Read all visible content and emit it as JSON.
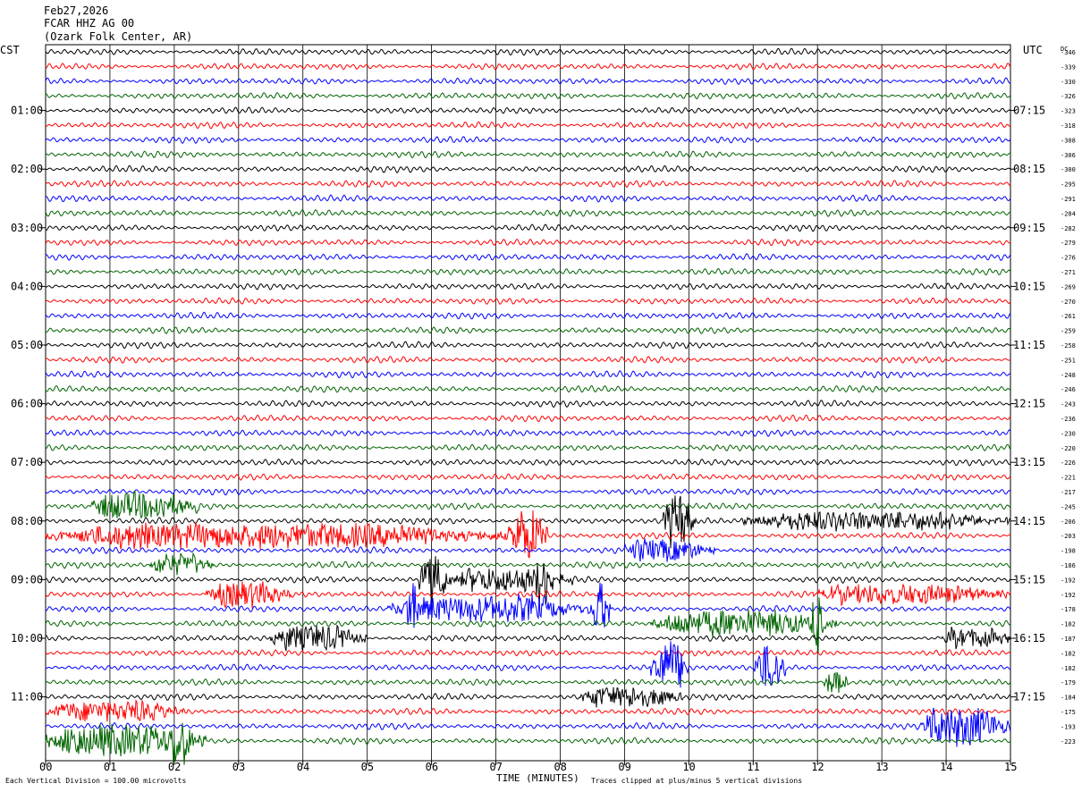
{
  "header": {
    "date": "Feb27,2026",
    "station": "FCAR HHZ AG 00",
    "location": "(Ozark Folk Center, AR)"
  },
  "chart_data": {
    "type": "line",
    "title": "FCAR HHZ AG 00",
    "xlabel": "TIME (MINUTES)",
    "left_axis_label": "CST",
    "right_axis_label": "UTC",
    "dc_label": "DC",
    "x_ticks": [
      "00",
      "01",
      "02",
      "03",
      "04",
      "05",
      "06",
      "07",
      "08",
      "09",
      "10",
      "11",
      "12",
      "13",
      "14",
      "15"
    ],
    "xlim": [
      0,
      15
    ],
    "cst_labels": [
      "01:00",
      "02:00",
      "03:00",
      "04:00",
      "05:00",
      "06:00",
      "07:00",
      "08:00",
      "09:00",
      "10:00",
      "11:00"
    ],
    "utc_labels": [
      "07:15",
      "08:15",
      "09:15",
      "10:15",
      "11:15",
      "12:15",
      "13:15",
      "14:15",
      "15:15",
      "16:15",
      "17:15"
    ],
    "dc_offsets": [
      -346,
      -339,
      -330,
      -326,
      -323,
      -318,
      -308,
      -306,
      -300,
      -295,
      -291,
      -284,
      -282,
      -279,
      -276,
      -271,
      -269,
      -270,
      -261,
      -259,
      -258,
      -251,
      -248,
      -246,
      -243,
      -236,
      -230,
      -220,
      -226,
      -221,
      -217,
      -245,
      -206,
      -203,
      -198,
      -186,
      -192,
      -192,
      -178,
      -182,
      -187,
      -182,
      -182,
      -179,
      -184,
      -175,
      -193,
      -223
    ],
    "trace_colors": [
      "#000000",
      "#ff0000",
      "#0000ff",
      "#006400"
    ],
    "events": [
      {
        "trace": 31,
        "start": 0.7,
        "end": 2.4,
        "amp": 1.8
      },
      {
        "trace": 33,
        "start": 0.0,
        "end": 7.3,
        "amp": 1.6
      },
      {
        "trace": 33,
        "start": 7.2,
        "end": 7.8,
        "amp": 3.5
      },
      {
        "trace": 32,
        "start": 9.6,
        "end": 10.1,
        "amp": 3.5
      },
      {
        "trace": 32,
        "start": 10.8,
        "end": 15.0,
        "amp": 1.2
      },
      {
        "trace": 34,
        "start": 9.0,
        "end": 10.4,
        "amp": 1.4
      },
      {
        "trace": 35,
        "start": 1.6,
        "end": 2.6,
        "amp": 1.3
      },
      {
        "trace": 36,
        "start": 5.8,
        "end": 6.3,
        "amp": 3.0
      },
      {
        "trace": 36,
        "start": 6.3,
        "end": 8.2,
        "amp": 1.5
      },
      {
        "trace": 36,
        "start": 7.6,
        "end": 7.9,
        "amp": 3.5
      },
      {
        "trace": 37,
        "start": 2.5,
        "end": 3.8,
        "amp": 1.6
      },
      {
        "trace": 37,
        "start": 11.9,
        "end": 15.0,
        "amp": 1.2
      },
      {
        "trace": 38,
        "start": 5.3,
        "end": 8.6,
        "amp": 1.6
      },
      {
        "trace": 38,
        "start": 5.6,
        "end": 5.8,
        "amp": 3.5
      },
      {
        "trace": 38,
        "start": 8.5,
        "end": 8.8,
        "amp": 3.5
      },
      {
        "trace": 39,
        "start": 9.4,
        "end": 12.3,
        "amp": 1.6
      },
      {
        "trace": 39,
        "start": 11.9,
        "end": 12.1,
        "amp": 4.0
      },
      {
        "trace": 40,
        "start": 3.5,
        "end": 5.0,
        "amp": 1.6
      },
      {
        "trace": 40,
        "start": 13.9,
        "end": 15.0,
        "amp": 1.3
      },
      {
        "trace": 42,
        "start": 9.4,
        "end": 10.0,
        "amp": 3.5
      },
      {
        "trace": 42,
        "start": 11.0,
        "end": 11.5,
        "amp": 3.0
      },
      {
        "trace": 43,
        "start": 12.1,
        "end": 12.5,
        "amp": 1.5
      },
      {
        "trace": 44,
        "start": 8.3,
        "end": 9.9,
        "amp": 1.4
      },
      {
        "trace": 45,
        "start": 0.0,
        "end": 2.2,
        "amp": 1.3
      },
      {
        "trace": 46,
        "start": 13.6,
        "end": 15.0,
        "amp": 2.5
      },
      {
        "trace": 47,
        "start": 0.0,
        "end": 2.5,
        "amp": 2.0
      },
      {
        "trace": 47,
        "start": 1.9,
        "end": 2.3,
        "amp": 3.5
      }
    ]
  },
  "footer": {
    "scale_note": "Each Vertical Division =  100.00 microvolts",
    "clip_note": "Traces clipped at plus/minus 5 vertical divisions"
  }
}
